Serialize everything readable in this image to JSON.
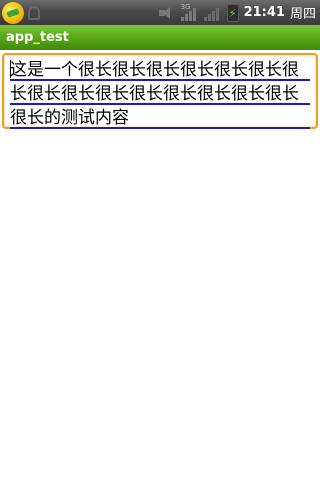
{
  "status_bar": {
    "notification_icon": "app-notification-icon",
    "usb_icon": "usb-icon",
    "mute_icon": "mute-icon",
    "network_type": "3G",
    "time": "21:41",
    "weekday": "周四"
  },
  "title_bar": {
    "title": "app_test"
  },
  "edit_text": {
    "value": "这是一个很长很长很长很长很长很长很长很长很长很长很长很长很长很长很长很长的测试内容"
  },
  "colors": {
    "title_bar_green": "#55a514",
    "focus_orange": "#f39c1f",
    "underline_blue": "#1c1cbc"
  }
}
